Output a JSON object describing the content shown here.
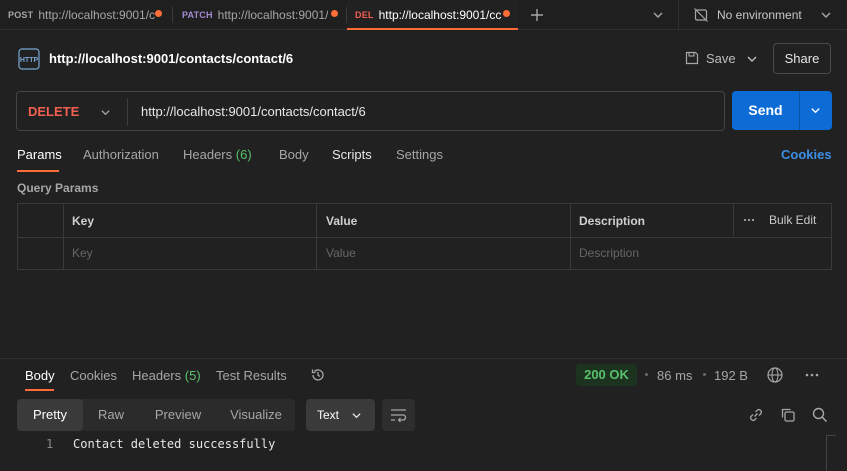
{
  "tabs": [
    {
      "method": "POST",
      "method_color": "#a6a6a6",
      "url": "http://localhost:9001/c",
      "active": false
    },
    {
      "method": "PATCH",
      "method_color": "#a58bd1",
      "url": "http://localhost:9001/",
      "active": false
    },
    {
      "method": "DEL",
      "method_color": "#f05f4f",
      "url": "http://localhost:9001/cc",
      "active": true
    }
  ],
  "environment": {
    "label": "No environment"
  },
  "request": {
    "title": "http://localhost:9001/contacts/contact/6",
    "save_label": "Save",
    "share_label": "Share",
    "method": "DELETE",
    "url": "http://localhost:9001/contacts/contact/6",
    "send_label": "Send"
  },
  "request_tabs": {
    "params": "Params",
    "authorization": "Authorization",
    "headers": "Headers",
    "headers_count": "(6)",
    "body": "Body",
    "scripts": "Scripts",
    "settings": "Settings",
    "cookies": "Cookies"
  },
  "query_params": {
    "title": "Query Params",
    "columns": {
      "key": "Key",
      "value": "Value",
      "description": "Description",
      "bulk_edit": "Bulk Edit"
    },
    "placeholders": {
      "key": "Key",
      "value": "Value",
      "description": "Description"
    }
  },
  "response": {
    "tabs": {
      "body": "Body",
      "cookies": "Cookies",
      "headers": "Headers",
      "headers_count": "(5)",
      "test_results": "Test Results"
    },
    "status": "200 OK",
    "time": "86 ms",
    "size": "192 B",
    "views": {
      "pretty": "Pretty",
      "raw": "Raw",
      "preview": "Preview",
      "visualize": "Visualize"
    },
    "format": "Text",
    "lines": [
      {
        "number": "1",
        "text": "Contact deleted successfully"
      }
    ]
  },
  "colors": {
    "accent": "#ff6c37",
    "send": "#0d6bd6",
    "delete": "#f05f4f",
    "success": "#59c16c",
    "link": "#3d8fe6"
  }
}
